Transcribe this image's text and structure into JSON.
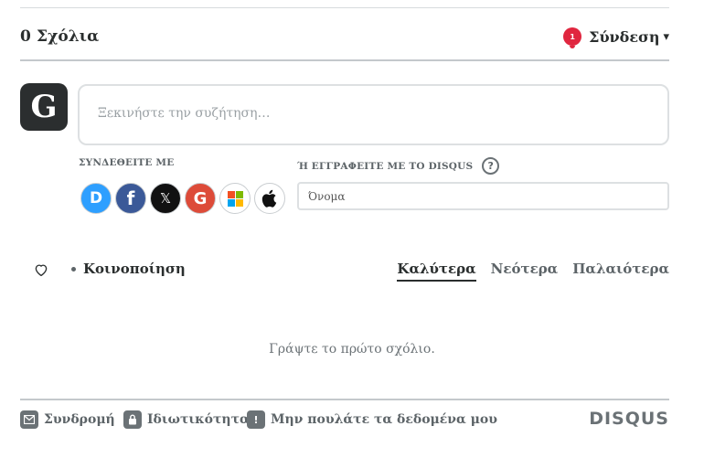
{
  "header": {
    "comment_count": "0 Σχόλια",
    "notification_count": "1",
    "login_label": "Σύνδεση",
    "login_caret": "▾"
  },
  "avatar": {
    "letter": "G"
  },
  "compose": {
    "placeholder": "Ξεκινήστε την συζήτηση…"
  },
  "auth": {
    "connect_label": "ΣΥΝΔΕΘΕΙΤΕ ΜΕ",
    "signup_label": "Ή ΕΓΓΡΑΦΕΙΤΕ ΜΕ ΤΟ DISQUS",
    "help_glyph": "?",
    "name_placeholder": "Όνομα",
    "providers": [
      {
        "name": "disqus",
        "glyph": "D",
        "color": "#2e9fff"
      },
      {
        "name": "facebook",
        "glyph": "f",
        "color": "#3b5998"
      },
      {
        "name": "x",
        "glyph": "𝕏",
        "color": "#111111"
      },
      {
        "name": "google",
        "glyph": "G",
        "color": "#dd4b39"
      },
      {
        "name": "microsoft",
        "glyph": "",
        "color": "#ffffff"
      },
      {
        "name": "apple",
        "glyph": "",
        "color": "#ffffff"
      }
    ]
  },
  "actions": {
    "share_label": "Κοινοποίηση",
    "sort": [
      {
        "label": "Καλύτερα",
        "active": true
      },
      {
        "label": "Νεότερα",
        "active": false
      },
      {
        "label": "Παλαιότερα",
        "active": false
      }
    ]
  },
  "empty_state": "Γράψτε το πρώτο σχόλιο.",
  "footer": {
    "subscribe": "Συνδρομή",
    "privacy": "Ιδιωτικότητα",
    "do_not_sell": "Μην πουλάτε τα δεδομένα μου",
    "do_not_sell_glyph": "!",
    "brand": "DISQUS"
  },
  "colors": {
    "accent_red": "#e0263f",
    "text_dark": "#2a2e2e",
    "text_muted": "#5d6468",
    "border": "#dde0e2"
  }
}
